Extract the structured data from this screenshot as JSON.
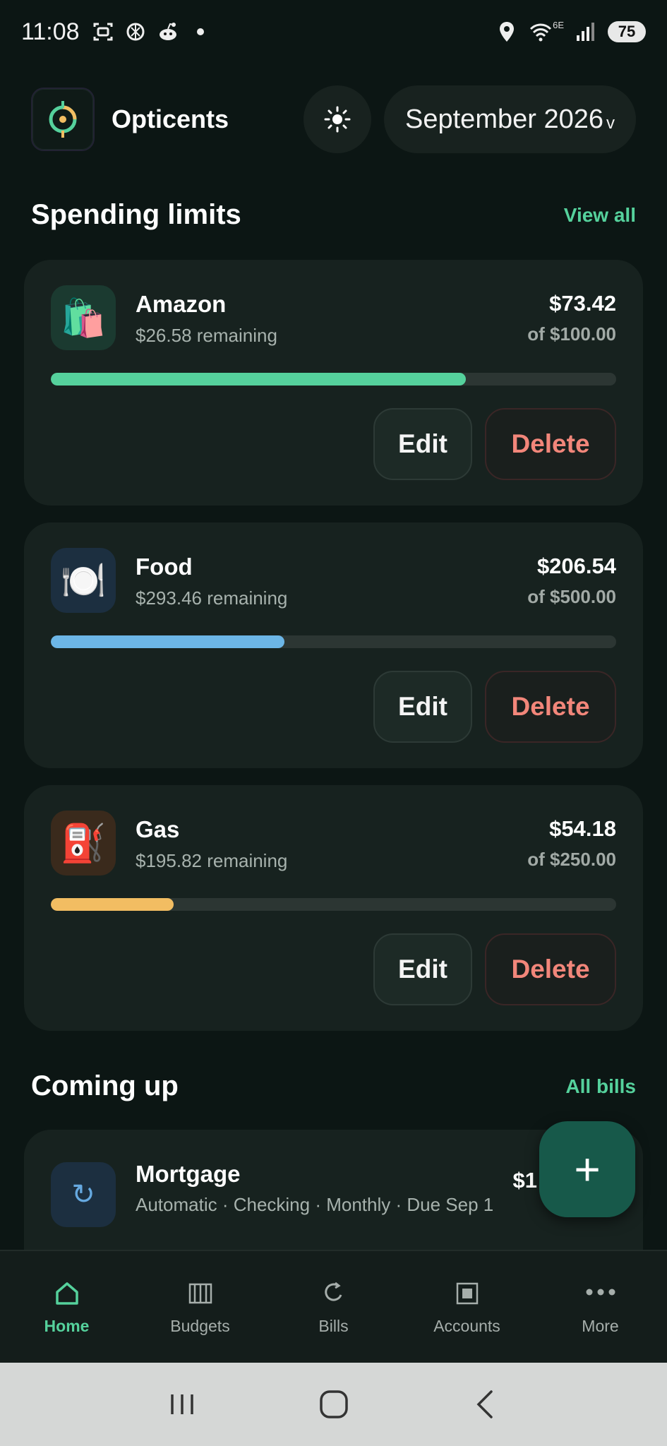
{
  "status_bar": {
    "time": "11:08",
    "network_label": "6E",
    "battery": "75"
  },
  "header": {
    "app_name": "Opticents",
    "month": "September 2026",
    "month_chevron": "v"
  },
  "spending": {
    "title": "Spending limits",
    "view_all": "View all",
    "items": [
      {
        "name": "Amazon",
        "icon": "shopping-bags-icon",
        "emoji": "🛍️",
        "remaining": "$26.58 remaining",
        "spent": "$73.42",
        "limit": "of $100.00",
        "progress": 0.7342,
        "color": "#55d19c",
        "icon_bg": "#1b3a30",
        "edit": "Edit",
        "delete": "Delete"
      },
      {
        "name": "Food",
        "icon": "plate-icon",
        "emoji": "🍽️",
        "remaining": "$293.46 remaining",
        "spent": "$206.54",
        "limit": "of $500.00",
        "progress": 0.4131,
        "color": "#6cb6e6",
        "icon_bg": "#1c2f40",
        "edit": "Edit",
        "delete": "Delete"
      },
      {
        "name": "Gas",
        "icon": "fuel-pump-icon",
        "emoji": "⛽",
        "remaining": "$195.82 remaining",
        "spent": "$54.18",
        "limit": "of $250.00",
        "progress": 0.2167,
        "color": "#f2bd62",
        "icon_bg": "#3a2a1c",
        "edit": "Edit",
        "delete": "Delete"
      }
    ]
  },
  "bills": {
    "title": "Coming up",
    "all_bills": "All bills",
    "items": [
      {
        "name": "Mortgage",
        "icon": "recurring-icon",
        "meta": "Automatic · Checking · Monthly · Due Sep 1",
        "amount": "$1"
      }
    ]
  },
  "fab_label": "+",
  "nav": {
    "items": [
      {
        "label": "Home",
        "icon": "home-icon",
        "active": true
      },
      {
        "label": "Budgets",
        "icon": "budgets-icon",
        "active": false
      },
      {
        "label": "Bills",
        "icon": "bills-icon",
        "active": false
      },
      {
        "label": "Accounts",
        "icon": "accounts-icon",
        "active": false
      },
      {
        "label": "More",
        "icon": "more-icon",
        "active": false
      }
    ]
  }
}
